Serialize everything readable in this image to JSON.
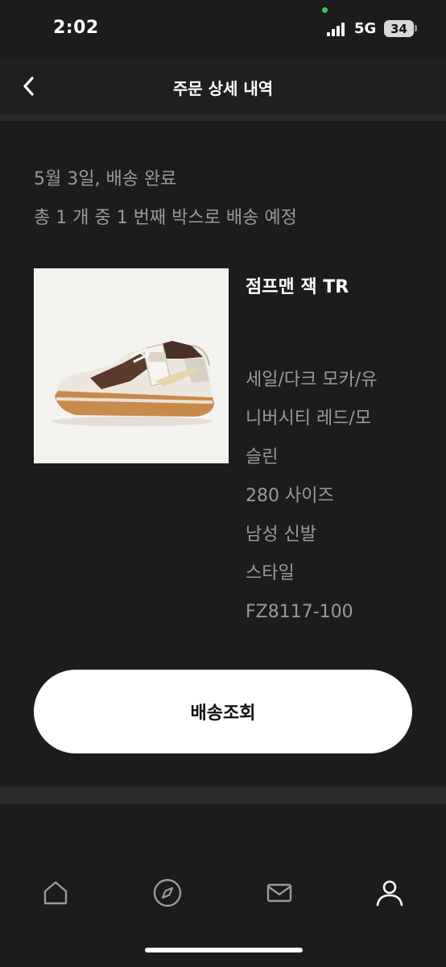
{
  "status_bar": {
    "time": "2:02",
    "network": "5G",
    "battery": "34"
  },
  "header": {
    "title": "주문 상세 내역",
    "back_icon": "chevron-left-icon"
  },
  "order": {
    "delivery_date": "5월 3일, 배송 완료",
    "delivery_note": "총 1 개 중 1 번째 박스로 배송 예정",
    "product": {
      "name": "점프맨 잭 TR",
      "details": [
        "세일/다크 모카/유",
        "니버시티 레드/모",
        "슬린",
        "280 사이즈",
        "남성 신발",
        "스타일",
        "FZ8117-100"
      ]
    },
    "track_button": "배송조회"
  },
  "bottom_nav": {
    "items": [
      {
        "icon": "home-icon"
      },
      {
        "icon": "compass-icon"
      },
      {
        "icon": "mail-icon"
      },
      {
        "icon": "profile-icon",
        "active": true
      }
    ]
  },
  "colors": {
    "background": "#1c1c1e",
    "muted_text": "#9a9a9c",
    "button_bg": "#ffffff"
  }
}
